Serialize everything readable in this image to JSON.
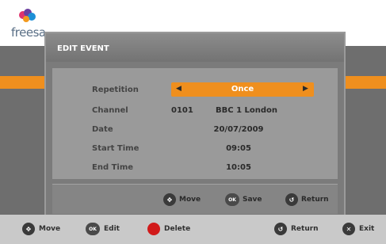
{
  "brand": {
    "logo_text": "freesa"
  },
  "dialog": {
    "title": "EDIT EVENT",
    "rows": {
      "repetition": {
        "label": "Repetition",
        "value": "Once"
      },
      "channel": {
        "label": "Channel",
        "number": "0101",
        "name": "BBC 1 London"
      },
      "date": {
        "label": "Date",
        "value": "20/07/2009"
      },
      "start_time": {
        "label": "Start Time",
        "value": "09:05"
      },
      "end_time": {
        "label": "End Time",
        "value": "10:05"
      }
    },
    "footer": {
      "move": "Move",
      "save": "Save",
      "return": "Return"
    }
  },
  "bottom_bar": {
    "move": "Move",
    "edit": "Edit",
    "delete": "Delete",
    "return": "Return",
    "exit": "Exit"
  },
  "colors": {
    "accent": "#ef8f1e",
    "panel": "#7b7b7b",
    "delete": "#d11a1a"
  }
}
